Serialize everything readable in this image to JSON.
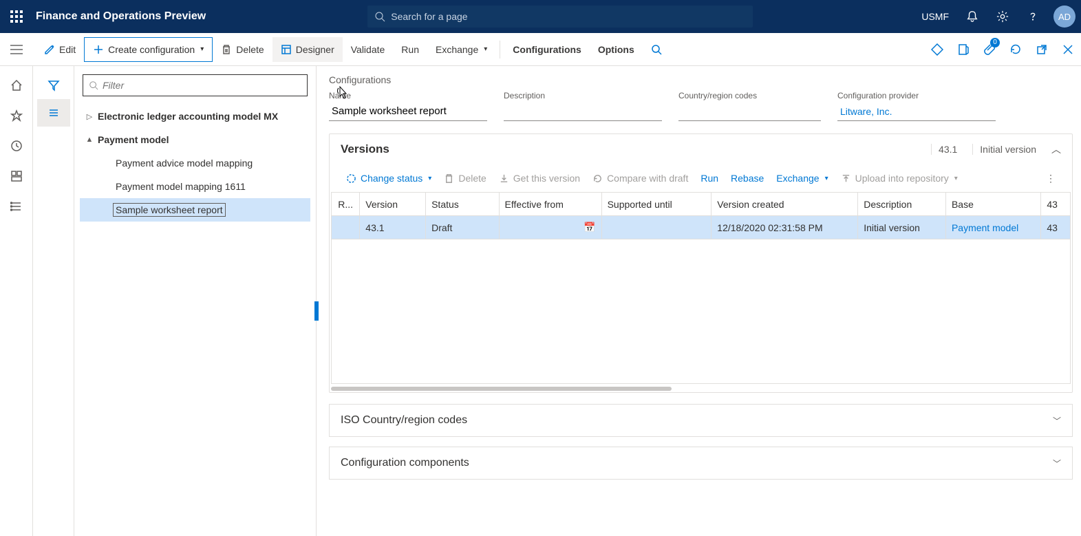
{
  "header": {
    "app_title": "Finance and Operations Preview",
    "search_placeholder": "Search for a page",
    "legal_entity": "USMF",
    "avatar_initials": "AD",
    "attach_badge": "0"
  },
  "commands": {
    "edit": "Edit",
    "create_config": "Create configuration",
    "delete": "Delete",
    "designer": "Designer",
    "validate": "Validate",
    "run": "Run",
    "exchange": "Exchange",
    "configurations": "Configurations",
    "options": "Options"
  },
  "tree": {
    "filter_placeholder": "Filter",
    "items": [
      {
        "label": "Electronic ledger accounting model MX",
        "bold": true,
        "caret": "right",
        "indent": 0
      },
      {
        "label": "Payment model",
        "bold": true,
        "caret": "down",
        "indent": 0
      },
      {
        "label": "Payment advice model mapping",
        "bold": false,
        "caret": "",
        "indent": 2
      },
      {
        "label": "Payment model mapping 1611",
        "bold": false,
        "caret": "",
        "indent": 2
      },
      {
        "label": "Sample worksheet report",
        "bold": false,
        "caret": "",
        "indent": 2,
        "selected": true
      }
    ]
  },
  "content": {
    "breadcrumb": "Configurations",
    "fields": {
      "name_label": "Name",
      "name_value": "Sample worksheet report",
      "desc_label": "Description",
      "desc_value": "",
      "country_label": "Country/region codes",
      "country_value": "",
      "provider_label": "Configuration provider",
      "provider_value": "Litware, Inc."
    },
    "versions": {
      "title": "Versions",
      "summary_version": "43.1",
      "summary_desc": "Initial version",
      "toolbar": {
        "change_status": "Change status",
        "delete": "Delete",
        "get_version": "Get this version",
        "compare": "Compare with draft",
        "run": "Run",
        "rebase": "Rebase",
        "exchange": "Exchange",
        "upload": "Upload into repository"
      },
      "columns": [
        "R...",
        "Version",
        "Status",
        "Effective from",
        "Supported until",
        "Version created",
        "Description",
        "Base",
        "43"
      ],
      "row": {
        "version": "43.1",
        "status": "Draft",
        "effective_from": "",
        "supported_until": "",
        "version_created": "12/18/2020 02:31:58 PM",
        "description": "Initial version",
        "base": "Payment model",
        "base_ver": "43"
      }
    },
    "sections": {
      "iso": "ISO Country/region codes",
      "components": "Configuration components"
    }
  }
}
